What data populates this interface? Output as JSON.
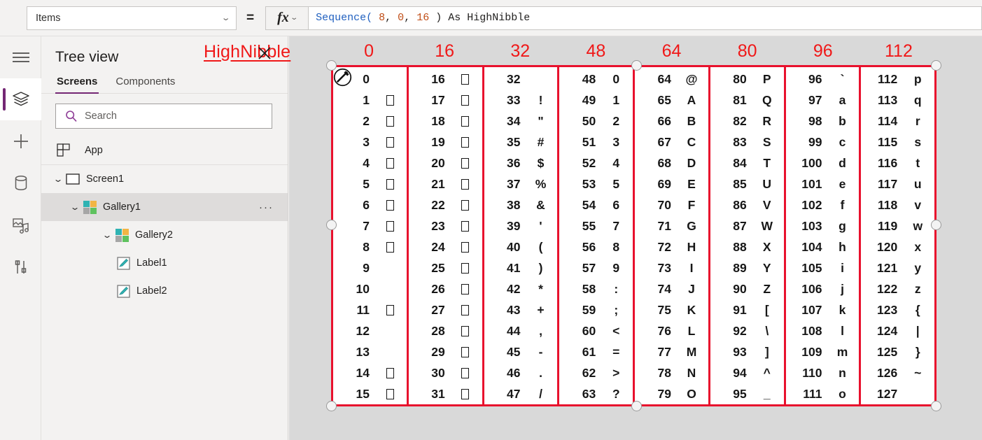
{
  "topbar": {
    "property_value": "Items",
    "equals": "=",
    "fx_label": "fx",
    "formula_tokens": [
      {
        "t": "Sequence(",
        "k": "fn"
      },
      {
        "t": " ",
        "k": "pl"
      },
      {
        "t": "8",
        "k": "num"
      },
      {
        "t": ", ",
        "k": "pl"
      },
      {
        "t": "0",
        "k": "num"
      },
      {
        "t": ", ",
        "k": "pl"
      },
      {
        "t": "16",
        "k": "num"
      },
      {
        "t": " ) As HighNibble",
        "k": "pl"
      }
    ],
    "formula_plain": "Sequence( 8, 0, 16 ) As HighNibble"
  },
  "rail": {
    "items": [
      {
        "name": "hamburger-menu-icon",
        "selected": false
      },
      {
        "name": "tree-view-icon",
        "selected": true
      },
      {
        "name": "insert-icon",
        "selected": false
      },
      {
        "name": "data-icon",
        "selected": false
      },
      {
        "name": "media-icon",
        "selected": false
      },
      {
        "name": "advanced-tools-icon",
        "selected": false
      }
    ]
  },
  "tree": {
    "title": "Tree view",
    "tabs": [
      {
        "label": "Screens",
        "active": true
      },
      {
        "label": "Components",
        "active": false
      }
    ],
    "search": {
      "placeholder": "Search",
      "value": ""
    },
    "app_item": {
      "label": "App"
    },
    "nodes": [
      {
        "label": "Screen1",
        "level": 0,
        "twisty": "⌄",
        "icon": "screen-icon",
        "selected": false,
        "menu": false
      },
      {
        "label": "Gallery1",
        "level": 1,
        "twisty": "⌄",
        "icon": "gallery-icon",
        "selected": true,
        "menu": true
      },
      {
        "label": "Gallery2",
        "level": 2,
        "twisty": "⌄",
        "icon": "gallery-icon",
        "selected": false,
        "menu": false
      },
      {
        "label": "Label1",
        "level": 3,
        "twisty": "",
        "icon": "label-icon",
        "selected": false,
        "menu": false
      },
      {
        "label": "Label2",
        "level": 3,
        "twisty": "",
        "icon": "label-icon",
        "selected": false,
        "menu": false
      }
    ],
    "more_menu": "···"
  },
  "canvas": {
    "high_nibble_label": "HighNibble",
    "column_headers": [
      "0",
      "16",
      "32",
      "48",
      "64",
      "80",
      "96",
      "112"
    ],
    "accent_red": "#e8112d",
    "label_red": "#f01818",
    "columns": [
      {
        "header": "0",
        "cells": [
          {
            "num": "0",
            "ch": "",
            "tofu": false
          },
          {
            "num": "1",
            "ch": "",
            "tofu": true
          },
          {
            "num": "2",
            "ch": "",
            "tofu": true
          },
          {
            "num": "3",
            "ch": "",
            "tofu": true
          },
          {
            "num": "4",
            "ch": "",
            "tofu": true
          },
          {
            "num": "5",
            "ch": "",
            "tofu": true
          },
          {
            "num": "6",
            "ch": "",
            "tofu": true
          },
          {
            "num": "7",
            "ch": "",
            "tofu": true
          },
          {
            "num": "8",
            "ch": "",
            "tofu": true
          },
          {
            "num": "9",
            "ch": "",
            "tofu": false
          },
          {
            "num": "10",
            "ch": "",
            "tofu": false
          },
          {
            "num": "11",
            "ch": "",
            "tofu": true
          },
          {
            "num": "12",
            "ch": "",
            "tofu": false
          },
          {
            "num": "13",
            "ch": "",
            "tofu": false
          },
          {
            "num": "14",
            "ch": "",
            "tofu": true
          },
          {
            "num": "15",
            "ch": "",
            "tofu": true
          }
        ]
      },
      {
        "header": "16",
        "cells": [
          {
            "num": "16",
            "ch": "",
            "tofu": true
          },
          {
            "num": "17",
            "ch": "",
            "tofu": true
          },
          {
            "num": "18",
            "ch": "",
            "tofu": true
          },
          {
            "num": "19",
            "ch": "",
            "tofu": true
          },
          {
            "num": "20",
            "ch": "",
            "tofu": true
          },
          {
            "num": "21",
            "ch": "",
            "tofu": true
          },
          {
            "num": "22",
            "ch": "",
            "tofu": true
          },
          {
            "num": "23",
            "ch": "",
            "tofu": true
          },
          {
            "num": "24",
            "ch": "",
            "tofu": true
          },
          {
            "num": "25",
            "ch": "",
            "tofu": true
          },
          {
            "num": "26",
            "ch": "",
            "tofu": true
          },
          {
            "num": "27",
            "ch": "",
            "tofu": true
          },
          {
            "num": "28",
            "ch": "",
            "tofu": true
          },
          {
            "num": "29",
            "ch": "",
            "tofu": true
          },
          {
            "num": "30",
            "ch": "",
            "tofu": true
          },
          {
            "num": "31",
            "ch": "",
            "tofu": true
          }
        ]
      },
      {
        "header": "32",
        "cells": [
          {
            "num": "32",
            "ch": "",
            "tofu": false
          },
          {
            "num": "33",
            "ch": "!",
            "tofu": false
          },
          {
            "num": "34",
            "ch": "\"",
            "tofu": false
          },
          {
            "num": "35",
            "ch": "#",
            "tofu": false
          },
          {
            "num": "36",
            "ch": "$",
            "tofu": false
          },
          {
            "num": "37",
            "ch": "%",
            "tofu": false
          },
          {
            "num": "38",
            "ch": "&",
            "tofu": false
          },
          {
            "num": "39",
            "ch": "'",
            "tofu": false
          },
          {
            "num": "40",
            "ch": "(",
            "tofu": false
          },
          {
            "num": "41",
            "ch": ")",
            "tofu": false
          },
          {
            "num": "42",
            "ch": "*",
            "tofu": false
          },
          {
            "num": "43",
            "ch": "+",
            "tofu": false
          },
          {
            "num": "44",
            "ch": ",",
            "tofu": false
          },
          {
            "num": "45",
            "ch": "-",
            "tofu": false
          },
          {
            "num": "46",
            "ch": ".",
            "tofu": false
          },
          {
            "num": "47",
            "ch": "/",
            "tofu": false
          }
        ]
      },
      {
        "header": "48",
        "cells": [
          {
            "num": "48",
            "ch": "0",
            "tofu": false
          },
          {
            "num": "49",
            "ch": "1",
            "tofu": false
          },
          {
            "num": "50",
            "ch": "2",
            "tofu": false
          },
          {
            "num": "51",
            "ch": "3",
            "tofu": false
          },
          {
            "num": "52",
            "ch": "4",
            "tofu": false
          },
          {
            "num": "53",
            "ch": "5",
            "tofu": false
          },
          {
            "num": "54",
            "ch": "6",
            "tofu": false
          },
          {
            "num": "55",
            "ch": "7",
            "tofu": false
          },
          {
            "num": "56",
            "ch": "8",
            "tofu": false
          },
          {
            "num": "57",
            "ch": "9",
            "tofu": false
          },
          {
            "num": "58",
            "ch": ":",
            "tofu": false
          },
          {
            "num": "59",
            "ch": ";",
            "tofu": false
          },
          {
            "num": "60",
            "ch": "<",
            "tofu": false
          },
          {
            "num": "61",
            "ch": "=",
            "tofu": false
          },
          {
            "num": "62",
            "ch": ">",
            "tofu": false
          },
          {
            "num": "63",
            "ch": "?",
            "tofu": false
          }
        ]
      },
      {
        "header": "64",
        "cells": [
          {
            "num": "64",
            "ch": "@",
            "tofu": false
          },
          {
            "num": "65",
            "ch": "A",
            "tofu": false
          },
          {
            "num": "66",
            "ch": "B",
            "tofu": false
          },
          {
            "num": "67",
            "ch": "C",
            "tofu": false
          },
          {
            "num": "68",
            "ch": "D",
            "tofu": false
          },
          {
            "num": "69",
            "ch": "E",
            "tofu": false
          },
          {
            "num": "70",
            "ch": "F",
            "tofu": false
          },
          {
            "num": "71",
            "ch": "G",
            "tofu": false
          },
          {
            "num": "72",
            "ch": "H",
            "tofu": false
          },
          {
            "num": "73",
            "ch": "I",
            "tofu": false
          },
          {
            "num": "74",
            "ch": "J",
            "tofu": false
          },
          {
            "num": "75",
            "ch": "K",
            "tofu": false
          },
          {
            "num": "76",
            "ch": "L",
            "tofu": false
          },
          {
            "num": "77",
            "ch": "M",
            "tofu": false
          },
          {
            "num": "78",
            "ch": "N",
            "tofu": false
          },
          {
            "num": "79",
            "ch": "O",
            "tofu": false
          }
        ]
      },
      {
        "header": "80",
        "cells": [
          {
            "num": "80",
            "ch": "P",
            "tofu": false
          },
          {
            "num": "81",
            "ch": "Q",
            "tofu": false
          },
          {
            "num": "82",
            "ch": "R",
            "tofu": false
          },
          {
            "num": "83",
            "ch": "S",
            "tofu": false
          },
          {
            "num": "84",
            "ch": "T",
            "tofu": false
          },
          {
            "num": "85",
            "ch": "U",
            "tofu": false
          },
          {
            "num": "86",
            "ch": "V",
            "tofu": false
          },
          {
            "num": "87",
            "ch": "W",
            "tofu": false
          },
          {
            "num": "88",
            "ch": "X",
            "tofu": false
          },
          {
            "num": "89",
            "ch": "Y",
            "tofu": false
          },
          {
            "num": "90",
            "ch": "Z",
            "tofu": false
          },
          {
            "num": "91",
            "ch": "[",
            "tofu": false
          },
          {
            "num": "92",
            "ch": "\\",
            "tofu": false
          },
          {
            "num": "93",
            "ch": "]",
            "tofu": false
          },
          {
            "num": "94",
            "ch": "^",
            "tofu": false
          },
          {
            "num": "95",
            "ch": "_",
            "tofu": false
          }
        ]
      },
      {
        "header": "96",
        "cells": [
          {
            "num": "96",
            "ch": "`",
            "tofu": false
          },
          {
            "num": "97",
            "ch": "a",
            "tofu": false
          },
          {
            "num": "98",
            "ch": "b",
            "tofu": false
          },
          {
            "num": "99",
            "ch": "c",
            "tofu": false
          },
          {
            "num": "100",
            "ch": "d",
            "tofu": false
          },
          {
            "num": "101",
            "ch": "e",
            "tofu": false
          },
          {
            "num": "102",
            "ch": "f",
            "tofu": false
          },
          {
            "num": "103",
            "ch": "g",
            "tofu": false
          },
          {
            "num": "104",
            "ch": "h",
            "tofu": false
          },
          {
            "num": "105",
            "ch": "i",
            "tofu": false
          },
          {
            "num": "106",
            "ch": "j",
            "tofu": false
          },
          {
            "num": "107",
            "ch": "k",
            "tofu": false
          },
          {
            "num": "108",
            "ch": "l",
            "tofu": false
          },
          {
            "num": "109",
            "ch": "m",
            "tofu": false
          },
          {
            "num": "110",
            "ch": "n",
            "tofu": false
          },
          {
            "num": "111",
            "ch": "o",
            "tofu": false
          }
        ]
      },
      {
        "header": "112",
        "cells": [
          {
            "num": "112",
            "ch": "p",
            "tofu": false
          },
          {
            "num": "113",
            "ch": "q",
            "tofu": false
          },
          {
            "num": "114",
            "ch": "r",
            "tofu": false
          },
          {
            "num": "115",
            "ch": "s",
            "tofu": false
          },
          {
            "num": "116",
            "ch": "t",
            "tofu": false
          },
          {
            "num": "117",
            "ch": "u",
            "tofu": false
          },
          {
            "num": "118",
            "ch": "v",
            "tofu": false
          },
          {
            "num": "119",
            "ch": "w",
            "tofu": false
          },
          {
            "num": "120",
            "ch": "x",
            "tofu": false
          },
          {
            "num": "121",
            "ch": "y",
            "tofu": false
          },
          {
            "num": "122",
            "ch": "z",
            "tofu": false
          },
          {
            "num": "123",
            "ch": "{",
            "tofu": false
          },
          {
            "num": "124",
            "ch": "|",
            "tofu": false
          },
          {
            "num": "125",
            "ch": "}",
            "tofu": false
          },
          {
            "num": "126",
            "ch": "~",
            "tofu": false
          },
          {
            "num": "127",
            "ch": "",
            "tofu": false
          }
        ]
      }
    ]
  }
}
